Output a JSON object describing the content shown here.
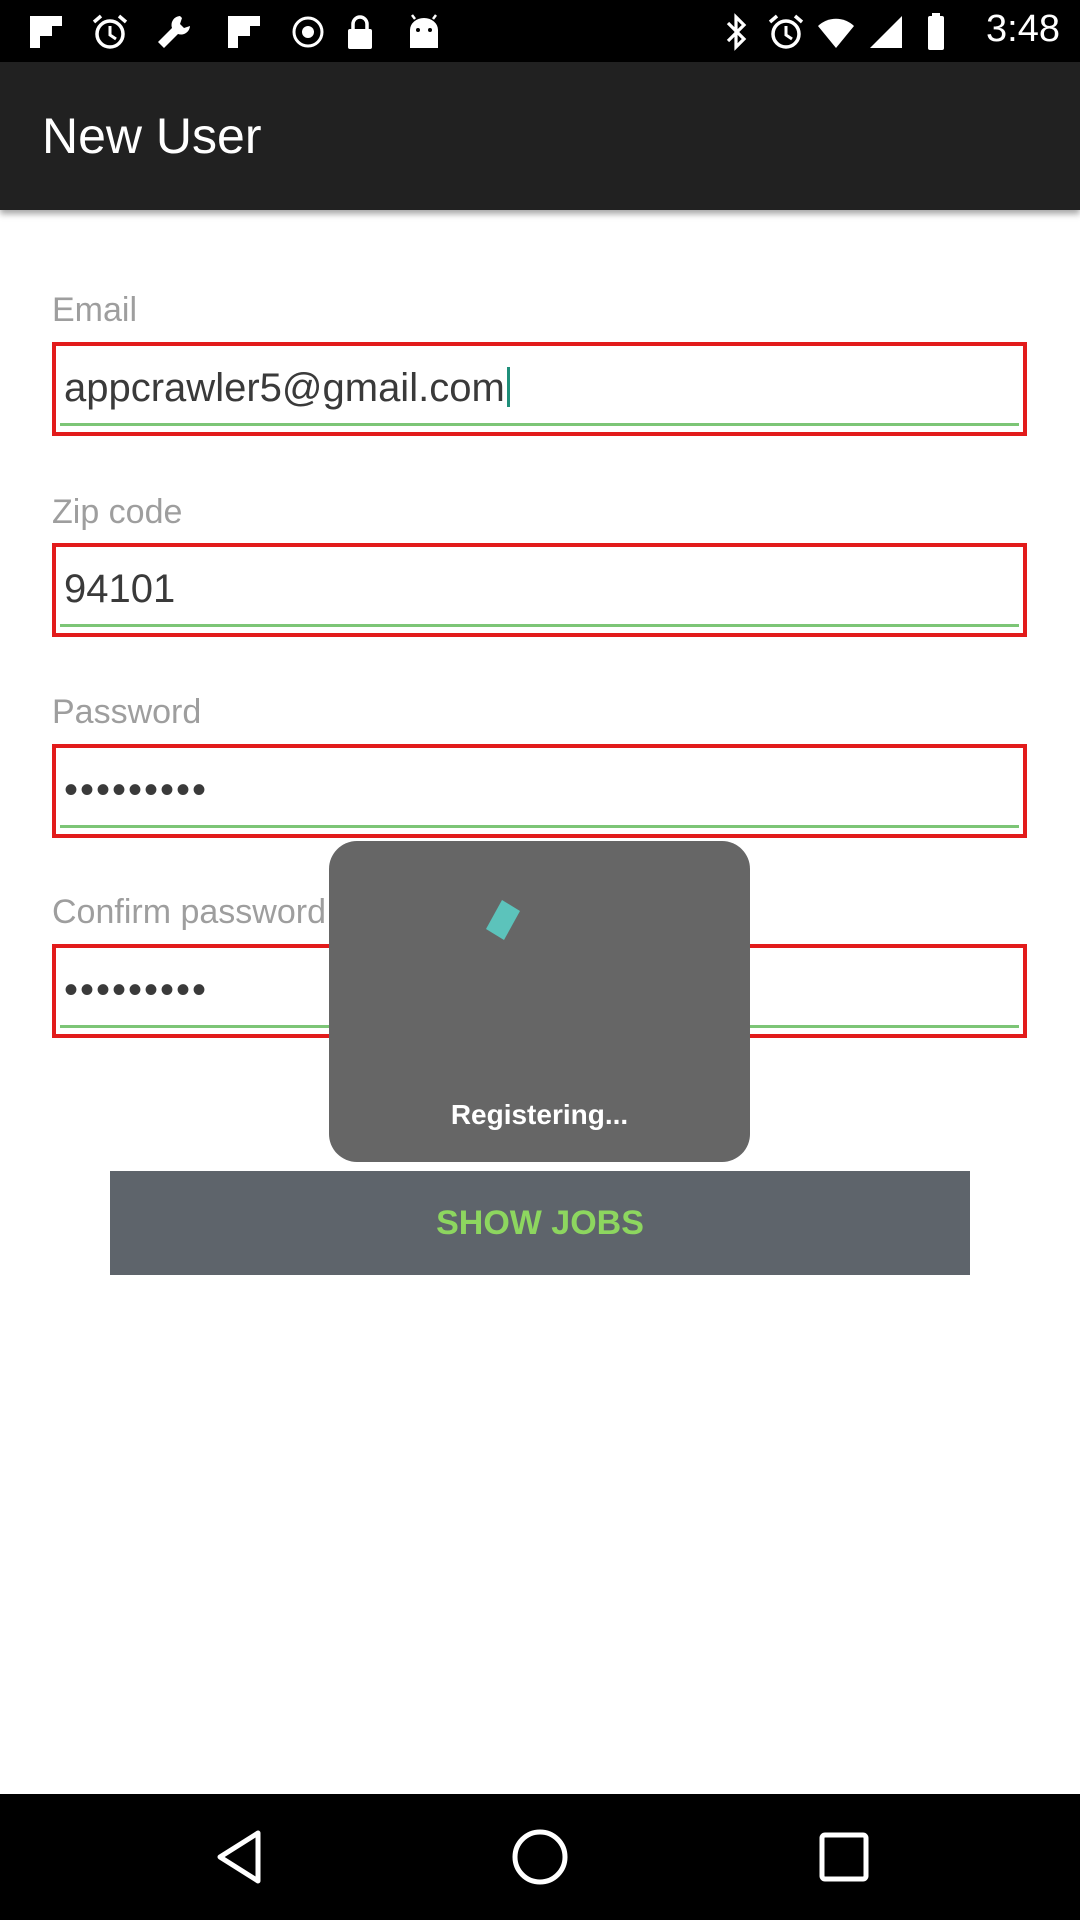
{
  "status_bar": {
    "time": "3:48",
    "left_icons": [
      "flipboard-icon",
      "alarm-icon",
      "wrench-icon",
      "flipboard-icon",
      "record-icon",
      "lock-icon",
      "android-icon"
    ],
    "right_icons": [
      "bluetooth-icon",
      "alarm-icon",
      "wifi-icon",
      "signal-icon",
      "battery-icon"
    ]
  },
  "app_bar": {
    "title": "New User"
  },
  "form": {
    "email": {
      "label": "Email",
      "value": "appcrawler5@gmail.com"
    },
    "zip": {
      "label": "Zip code",
      "value": "94101"
    },
    "password": {
      "label": "Password",
      "value": "•••••••••"
    },
    "confirm": {
      "label": "Confirm password",
      "value": "•••••••••"
    }
  },
  "button": {
    "label": "SHOW JOBS"
  },
  "dialog": {
    "message": "Registering..."
  },
  "nav_bar": {
    "icons": [
      "back-icon",
      "home-icon",
      "recents-icon"
    ]
  },
  "colors": {
    "app_bar": "#212121",
    "field_border": "#e21b1b",
    "underline": "#7cc576",
    "button_bg": "#5e646b",
    "button_text": "#8dd65f",
    "spinner": "#5cc3bb"
  }
}
